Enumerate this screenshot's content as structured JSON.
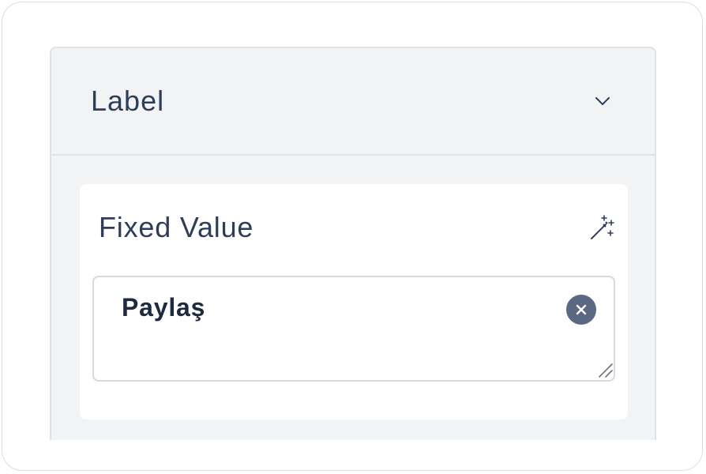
{
  "section": {
    "title": "Label",
    "collapse_icon": "chevron-down-icon"
  },
  "card": {
    "title": "Fixed Value",
    "action_icon": "magic-wand-icon",
    "input": {
      "value": "Paylaş",
      "clear_icon": "clear-icon",
      "resize_icon": "resize-handle-icon"
    }
  },
  "colors": {
    "panel_bg": "#f2f3f5",
    "text": "#2e3e58",
    "clear_button": "#5b6783"
  }
}
